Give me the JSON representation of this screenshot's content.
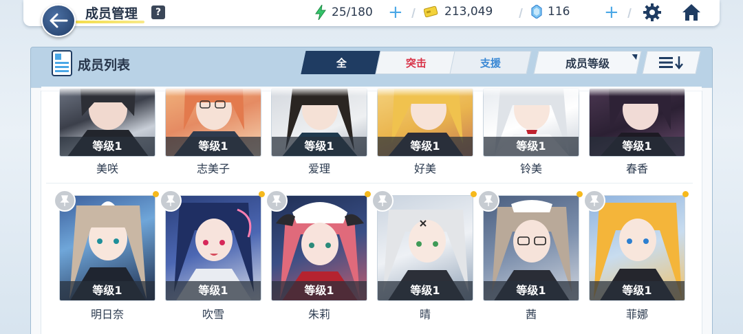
{
  "header": {
    "title": "成员管理",
    "help_label": "?",
    "stamina": "25/180",
    "credits": "213,049",
    "gems": "116",
    "plus": "+",
    "colors": {
      "accent": "#1f3c62",
      "plus": "#4aa7e6",
      "stamina": "#34c46a",
      "gem": "#4aa7e6"
    }
  },
  "panel": {
    "title": "成员列表",
    "tabs": [
      {
        "label": "全",
        "active": true
      },
      {
        "label": "突击",
        "color": "#d83247"
      },
      {
        "label": "支援",
        "color": "#3a88d4"
      }
    ],
    "sort_label": "成员等级"
  },
  "members_top": [
    {
      "level": "等级1",
      "name": "美咲"
    },
    {
      "level": "等级1",
      "name": "志美子"
    },
    {
      "level": "等级1",
      "name": "爱理"
    },
    {
      "level": "等级1",
      "name": "好美"
    },
    {
      "level": "等级1",
      "name": "铃美"
    },
    {
      "level": "等级1",
      "name": "春香"
    }
  ],
  "members_bottom": [
    {
      "level": "等级1",
      "name": "明日奈"
    },
    {
      "level": "等级1",
      "name": "吹雪"
    },
    {
      "level": "等级1",
      "name": "朱莉"
    },
    {
      "level": "等级1",
      "name": "晴"
    },
    {
      "level": "等级1",
      "name": "茜"
    },
    {
      "level": "等级1",
      "name": "菲娜"
    }
  ]
}
